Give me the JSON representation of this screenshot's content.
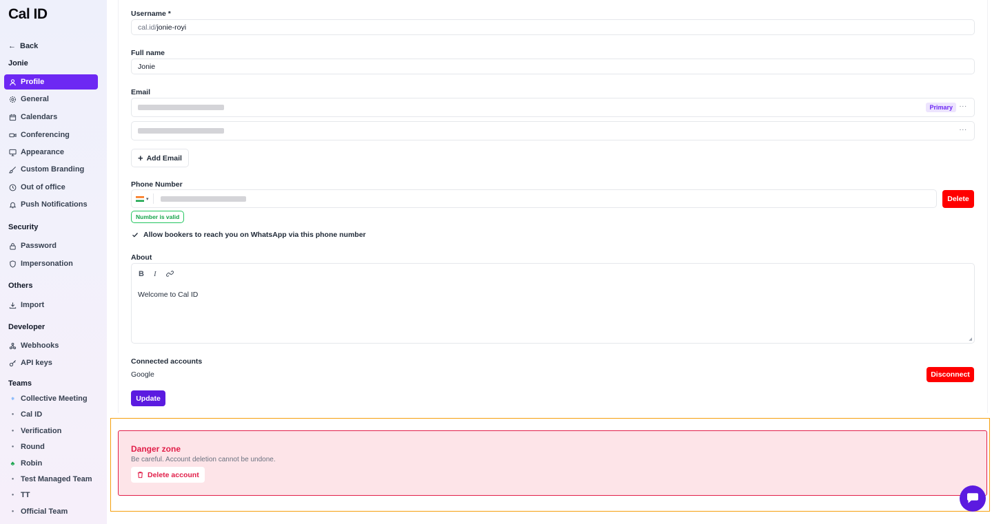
{
  "brand": {
    "logo": "Cal ID",
    "accent": "#6d28f3",
    "danger": "#ff0000"
  },
  "sidebar": {
    "back_label": "Back",
    "user_name": "Jonie",
    "account_items": [
      {
        "label": "Profile",
        "icon": "user-icon",
        "active": true
      },
      {
        "label": "General",
        "icon": "gear-icon",
        "active": false
      },
      {
        "label": "Calendars",
        "icon": "calendar-icon",
        "active": false
      },
      {
        "label": "Conferencing",
        "icon": "video-icon",
        "active": false
      },
      {
        "label": "Appearance",
        "icon": "monitor-icon",
        "active": false
      },
      {
        "label": "Custom Branding",
        "icon": "brush-icon",
        "active": false
      },
      {
        "label": "Out of office",
        "icon": "clock-icon",
        "active": false
      },
      {
        "label": "Push Notifications",
        "icon": "bell-icon",
        "active": false
      }
    ],
    "security_heading": "Security",
    "security_items": [
      {
        "label": "Password",
        "icon": "lock-icon"
      },
      {
        "label": "Impersonation",
        "icon": "shield-icon"
      }
    ],
    "others_heading": "Others",
    "others_items": [
      {
        "label": "Import",
        "icon": "import-icon"
      }
    ],
    "developer_heading": "Developer",
    "developer_items": [
      {
        "label": "Webhooks",
        "icon": "webhook-icon"
      },
      {
        "label": "API keys",
        "icon": "key-icon"
      }
    ],
    "teams_heading": "Teams",
    "teams_items": [
      {
        "label": "Collective Meeting",
        "avatar": ""
      },
      {
        "label": "Cal ID",
        "avatar": ""
      },
      {
        "label": "Verification",
        "avatar": ""
      },
      {
        "label": "Round",
        "avatar": ""
      },
      {
        "label": "Robin",
        "avatar": ""
      },
      {
        "label": "Test Managed Team",
        "avatar": ""
      },
      {
        "label": "TT",
        "avatar": ""
      },
      {
        "label": "Official Team",
        "avatar": ""
      }
    ]
  },
  "form": {
    "username_label": "Username *",
    "username_prefix": "cal.id/",
    "username_value": "jonie-royi",
    "fullname_label": "Full name",
    "fullname_value": "Jonie",
    "email_label": "Email",
    "primary_badge": "Primary",
    "more_label": "...",
    "add_email_label": "Add Email",
    "phone_label": "Phone Number",
    "phone_delete_label": "Delete",
    "phone_valid_label": "Number is valid",
    "whatsapp_label": "Allow bookers to reach you on WhatsApp via this phone number",
    "about_label": "About",
    "about_toolbar": {
      "bold": "B",
      "italic": "I"
    },
    "about_text": "Welcome to Cal ID",
    "connected_label": "Connected accounts",
    "connected_provider": "Google",
    "disconnect_label": "Disconnect",
    "update_label": "Update"
  },
  "danger_zone": {
    "title": "Danger zone",
    "description": "Be careful. Account deletion cannot be undone.",
    "delete_label": "Delete account"
  }
}
